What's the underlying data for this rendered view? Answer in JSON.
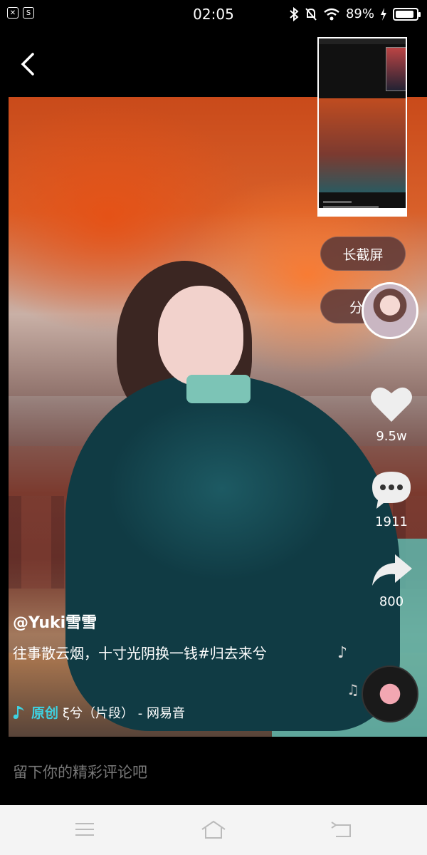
{
  "status_bar": {
    "time": "02:05",
    "battery": "89%",
    "battery_level": 0.89,
    "left_icons": [
      "sim-x-icon",
      "notification-app-icon"
    ],
    "right_icons": [
      "bluetooth-icon",
      "mute-icon",
      "wifi-icon",
      "charging-icon"
    ]
  },
  "header": {
    "back_icon": "chevron-left-icon"
  },
  "side_actions": {
    "long_screenshot": "长截屏",
    "share": "分享",
    "likes": "9.5w",
    "comments": "1911",
    "shares": "800"
  },
  "caption": {
    "username": "@Yuki雪雪",
    "description": "往事散云烟，十寸光阴换一钱#归去来兮",
    "music_tag": "原创",
    "music_title": "ξ兮（片段） - 网易音"
  },
  "comment": {
    "placeholder": "留下你的精彩评论吧"
  },
  "nav": {
    "icons": [
      "menu-icon",
      "home-icon",
      "back-icon"
    ]
  },
  "colors": {
    "accent": "#3fd1e0",
    "pill_bg": "#5a3737",
    "nav_bg": "#f4f4f4"
  }
}
